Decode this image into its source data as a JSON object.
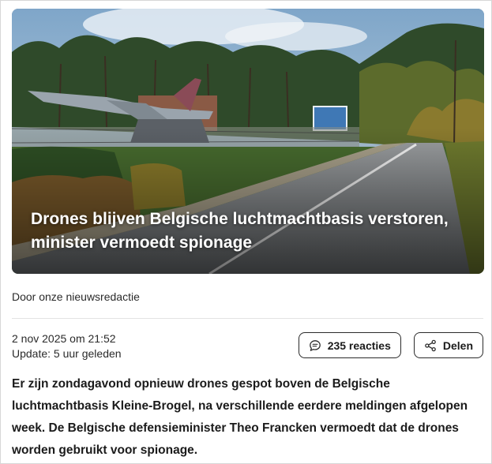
{
  "article": {
    "headline": "Drones blijven Belgische luchtmachtbasis verstoren, minister vermoedt spionage",
    "byline": "Door onze nieuwsredactie",
    "published": "2 nov 2025 om 21:52",
    "updated": "Update: 5 uur geleden",
    "lead": "Er zijn zondagavond opnieuw drones gespot boven de Belgische luchtmachtbasis Kleine-Brogel, na verschillende eerdere meldingen afgelopen week. De Belgische defensieminister Theo Francken vermoedt dat de drones worden gebruikt voor spionage."
  },
  "actions": {
    "comments_label": "235 reacties",
    "comments_icon": "comment-icon",
    "share_label": "Delen",
    "share_icon": "share-icon"
  }
}
